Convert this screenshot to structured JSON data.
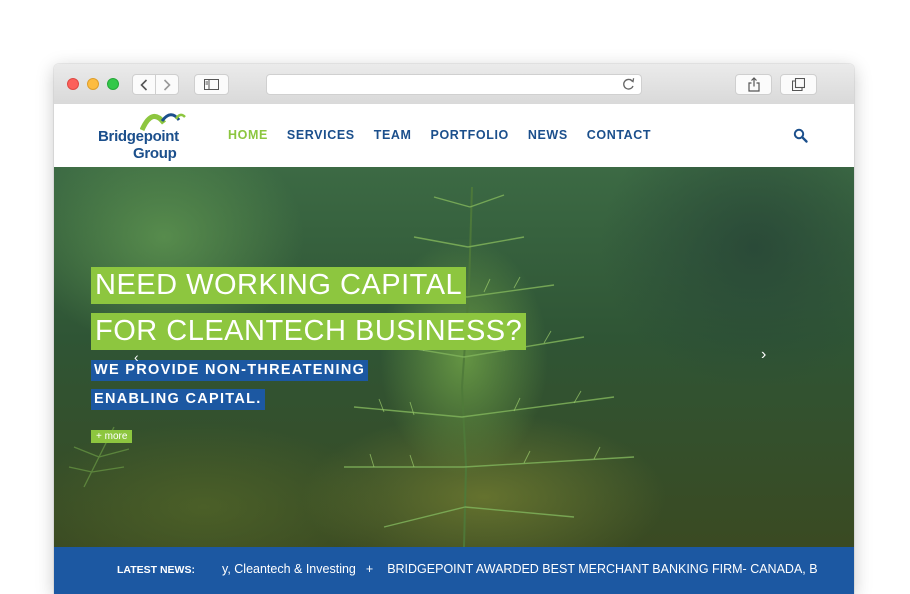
{
  "browser": {
    "url": ""
  },
  "site": {
    "logo": {
      "line1": "Bridgepoint",
      "line2": "Group"
    },
    "menu": [
      {
        "label": "HOME",
        "active": true
      },
      {
        "label": "SERVICES",
        "active": false
      },
      {
        "label": "TEAM",
        "active": false
      },
      {
        "label": "PORTFOLIO",
        "active": false
      },
      {
        "label": "NEWS",
        "active": false
      },
      {
        "label": "CONTACT",
        "active": false
      }
    ]
  },
  "hero": {
    "headline_line1": "NEED WORKING CAPITAL",
    "headline_line2": "FOR CLEANTECH BUSINESS?",
    "subline1": "WE PROVIDE NON-THREATENING",
    "subline2": "ENABLING CAPITAL.",
    "more_label": "+ more",
    "prev_arrow": "‹",
    "next_arrow": "›"
  },
  "news": {
    "label": "LATEST NEWS:",
    "item1": "y, Cleantech & Investing",
    "separator": "+",
    "item2": "BRIDGEPOINT AWARDED BEST MERCHANT BANKING FIRM- CANADA, BY CORPC"
  },
  "colors": {
    "brand_blue": "#1c58a2",
    "brand_green": "#8dc63f",
    "logo_blue": "#1b4f8c"
  },
  "icons": [
    "back-arrow-icon",
    "forward-arrow-icon",
    "sidebar-icon",
    "reload-icon",
    "share-icon",
    "tabs-icon",
    "search-icon"
  ]
}
